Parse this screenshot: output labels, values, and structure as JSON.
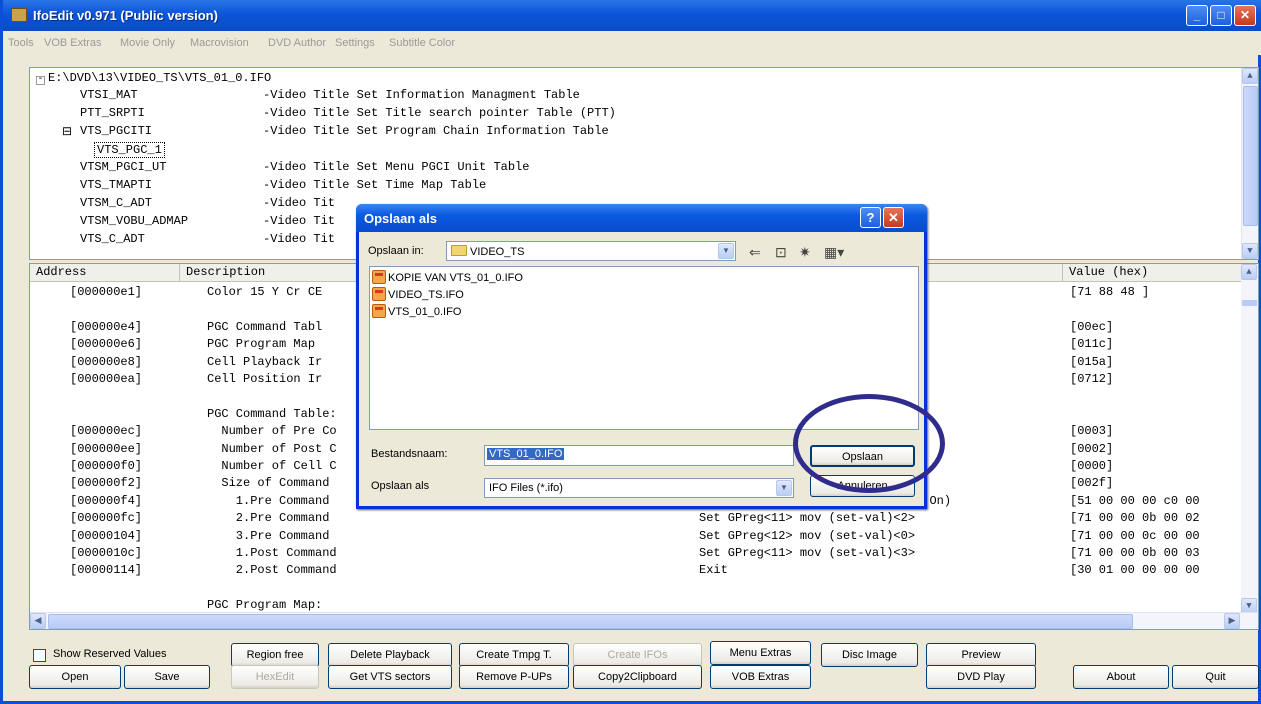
{
  "app": {
    "title": "IfoEdit v0.971 (Public version)"
  },
  "menu": [
    "Tools",
    "VOB Extras",
    "Movie Only",
    "Macrovision",
    "DVD Author",
    "Settings",
    "Subtitle Color"
  ],
  "tree": {
    "root": "E:\\DVD\\13\\VIDEO_TS\\VTS_01_0.IFO",
    "nodes": [
      {
        "name": "VTSI_MAT",
        "desc": "-Video Title Set Information Managment Table"
      },
      {
        "name": "PTT_SRPTI",
        "desc": "-Video Title Set Title search pointer Table (PTT)"
      },
      {
        "name": "VTS_PGCITI",
        "desc": "-Video Title Set Program Chain Information Table"
      },
      {
        "name": "VTS_PGC_1",
        "desc": ""
      },
      {
        "name": "VTSM_PGCI_UT",
        "desc": "-Video Title Set Menu PGCI Unit Table"
      },
      {
        "name": "VTS_TMAPTI",
        "desc": "-Video Title Set Time Map Table"
      },
      {
        "name": "VTSM_C_ADT",
        "desc": "-Video Tit"
      },
      {
        "name": "VTSM_VOBU_ADMAP",
        "desc": "-Video Tit"
      },
      {
        "name": "VTS_C_ADT",
        "desc": "-Video Tit"
      }
    ]
  },
  "table": {
    "headers": [
      "Address",
      "Description",
      "Value (hex)"
    ],
    "rows": [
      {
        "addr": "[000000e1]",
        "desc": "Color 15 Y Cr CE",
        "val": "",
        "hex": "[71 88 48 ]"
      },
      {
        "addr": "",
        "desc": "",
        "val": "",
        "hex": ""
      },
      {
        "addr": "[000000e4]",
        "desc": "PGC Command Tabl",
        "val": "",
        "hex": "[00ec]"
      },
      {
        "addr": "[000000e6]",
        "desc": "PGC Program Map",
        "val": "",
        "hex": "[011c]"
      },
      {
        "addr": "[000000e8]",
        "desc": "Cell Playback Ir",
        "val": "",
        "hex": "[015a]"
      },
      {
        "addr": "[000000ea]",
        "desc": "Cell Position Ir",
        "val": "",
        "hex": "[0712]"
      },
      {
        "addr": "",
        "desc": "",
        "val": "",
        "hex": ""
      },
      {
        "addr": "",
        "desc": "PGC Command Table:",
        "val": "",
        "hex": ""
      },
      {
        "addr": "[000000ec]",
        "desc": "  Number of Pre Co",
        "val": "",
        "hex": "[0003]"
      },
      {
        "addr": "[000000ee]",
        "desc": "  Number of Post C",
        "val": "",
        "hex": "[0002]"
      },
      {
        "addr": "[000000f0]",
        "desc": "  Number of Cell C",
        "val": "",
        "hex": "[0000]"
      },
      {
        "addr": "[000000f2]",
        "desc": "  Size of Command",
        "val": "",
        "hex": "[002f]"
      },
      {
        "addr": "[000000f4]",
        "desc": "    1.Pre Command",
        "val": "                      Stream: 0(On)",
        "hex": "[51 00 00 00 c0 00"
      },
      {
        "addr": "[000000fc]",
        "desc": "    2.Pre Command",
        "val": "Set GPreg<11> mov (set-val)<2>",
        "hex": "[71 00 00 0b 00 02"
      },
      {
        "addr": "[00000104]",
        "desc": "    3.Pre Command",
        "val": "Set GPreg<12> mov (set-val)<0>",
        "hex": "[71 00 00 0c 00 00"
      },
      {
        "addr": "[0000010c]",
        "desc": "    1.Post Command",
        "val": "Set GPreg<11> mov (set-val)<3>",
        "hex": "[71 00 00 0b 00 03"
      },
      {
        "addr": "[00000114]",
        "desc": "    2.Post Command",
        "val": "Exit",
        "hex": "[30 01 00 00 00 00"
      },
      {
        "addr": "",
        "desc": "",
        "val": "",
        "hex": ""
      },
      {
        "addr": "",
        "desc": "PGC Program Map:",
        "val": "",
        "hex": ""
      }
    ]
  },
  "buttons": {
    "show_reserved": "Show Reserved Values",
    "open": "Open",
    "save": "Save",
    "region_free": "Region free",
    "hexedit": "HexEdit",
    "delete_playback": "Delete Playback",
    "get_vts_sectors": "Get VTS sectors",
    "create_tmpg": "Create Tmpg T.",
    "remove_pups": "Remove P-UPs",
    "create_ifos": "Create IFOs",
    "copy2clipboard": "Copy2Clipboard",
    "menu_extras": "Menu Extras",
    "vob_extras": "VOB Extras",
    "disc_image": "Disc Image",
    "preview": "Preview",
    "dvd_play": "DVD Play",
    "about": "About",
    "quit": "Quit"
  },
  "dialog": {
    "title": "Opslaan als",
    "save_in_label": "Opslaan in:",
    "save_in_value": "VIDEO_TS",
    "files": [
      "KOPIE VAN VTS_01_0.IFO",
      "VIDEO_TS.IFO",
      "VTS_01_0.IFO"
    ],
    "filename_label": "Bestandsnaam:",
    "filename_value": "VTS_01_0.IFO",
    "type_label": "Opslaan als",
    "type_value": "IFO Files (*.ifo)",
    "save_button": "Opslaan",
    "cancel_button": "Annuleren"
  }
}
